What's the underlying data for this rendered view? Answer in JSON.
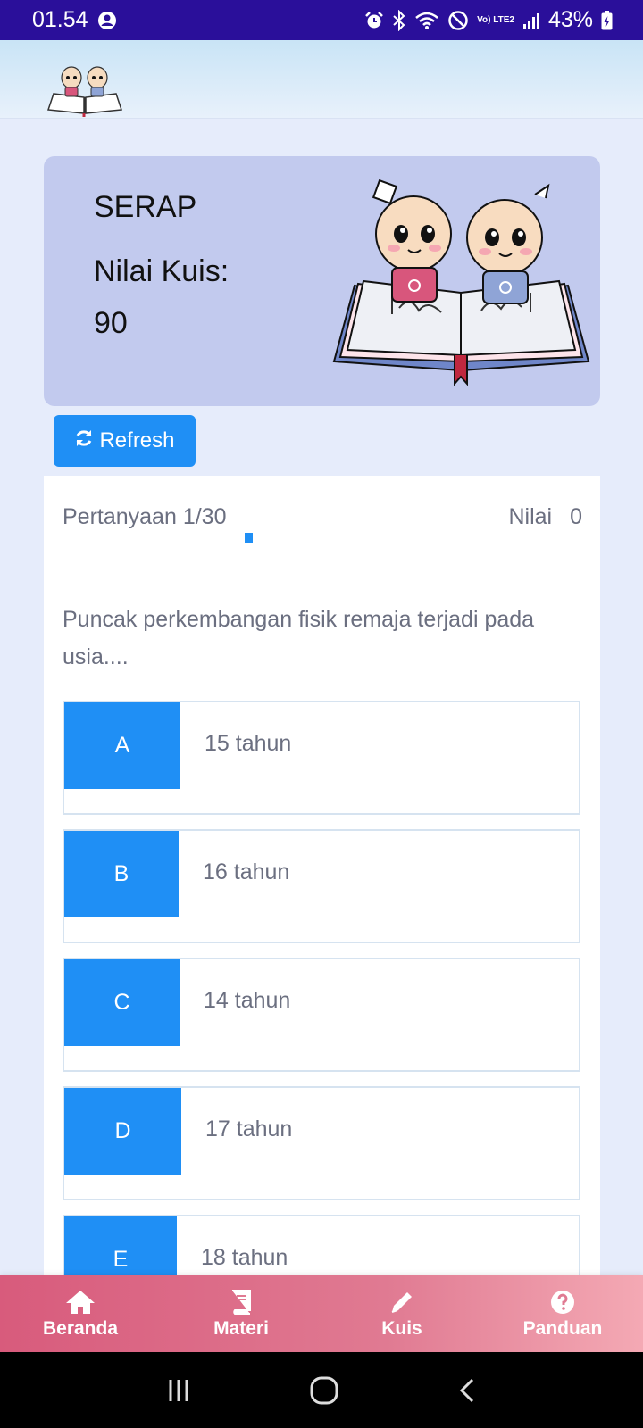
{
  "status_bar": {
    "time": "01.54",
    "battery": "43%",
    "network_label": "Vo) LTE2"
  },
  "hero": {
    "name": "SERAP",
    "score_label": "Nilai Kuis:",
    "score_value": "90"
  },
  "refresh": {
    "label": "Refresh",
    "icon": "refresh-icon"
  },
  "quiz": {
    "progress_text": "Pertanyaan 1/30",
    "progress_fraction": 0.033,
    "score_label": "Nilai",
    "score_value": "0",
    "question": "Puncak perkembangan fisik remaja terjadi pada usia....",
    "answers": [
      {
        "letter": "A",
        "text": "15 tahun"
      },
      {
        "letter": "B",
        "text": "16 tahun"
      },
      {
        "letter": "C",
        "text": "14 tahun"
      },
      {
        "letter": "D",
        "text": "17 tahun"
      },
      {
        "letter": "E",
        "text": "18 tahun"
      }
    ]
  },
  "nav": {
    "items": [
      {
        "label": "Beranda",
        "icon": "home-icon"
      },
      {
        "label": "Materi",
        "icon": "book-icon"
      },
      {
        "label": "Kuis",
        "icon": "pencil-icon"
      },
      {
        "label": "Panduan",
        "icon": "help-icon"
      }
    ]
  },
  "colors": {
    "status_bar": "#2a0f9a",
    "accent": "#1f8ff5",
    "hero_card": "#c2caee",
    "nav_start": "#d85b7c",
    "nav_end": "#f4a9b4"
  }
}
